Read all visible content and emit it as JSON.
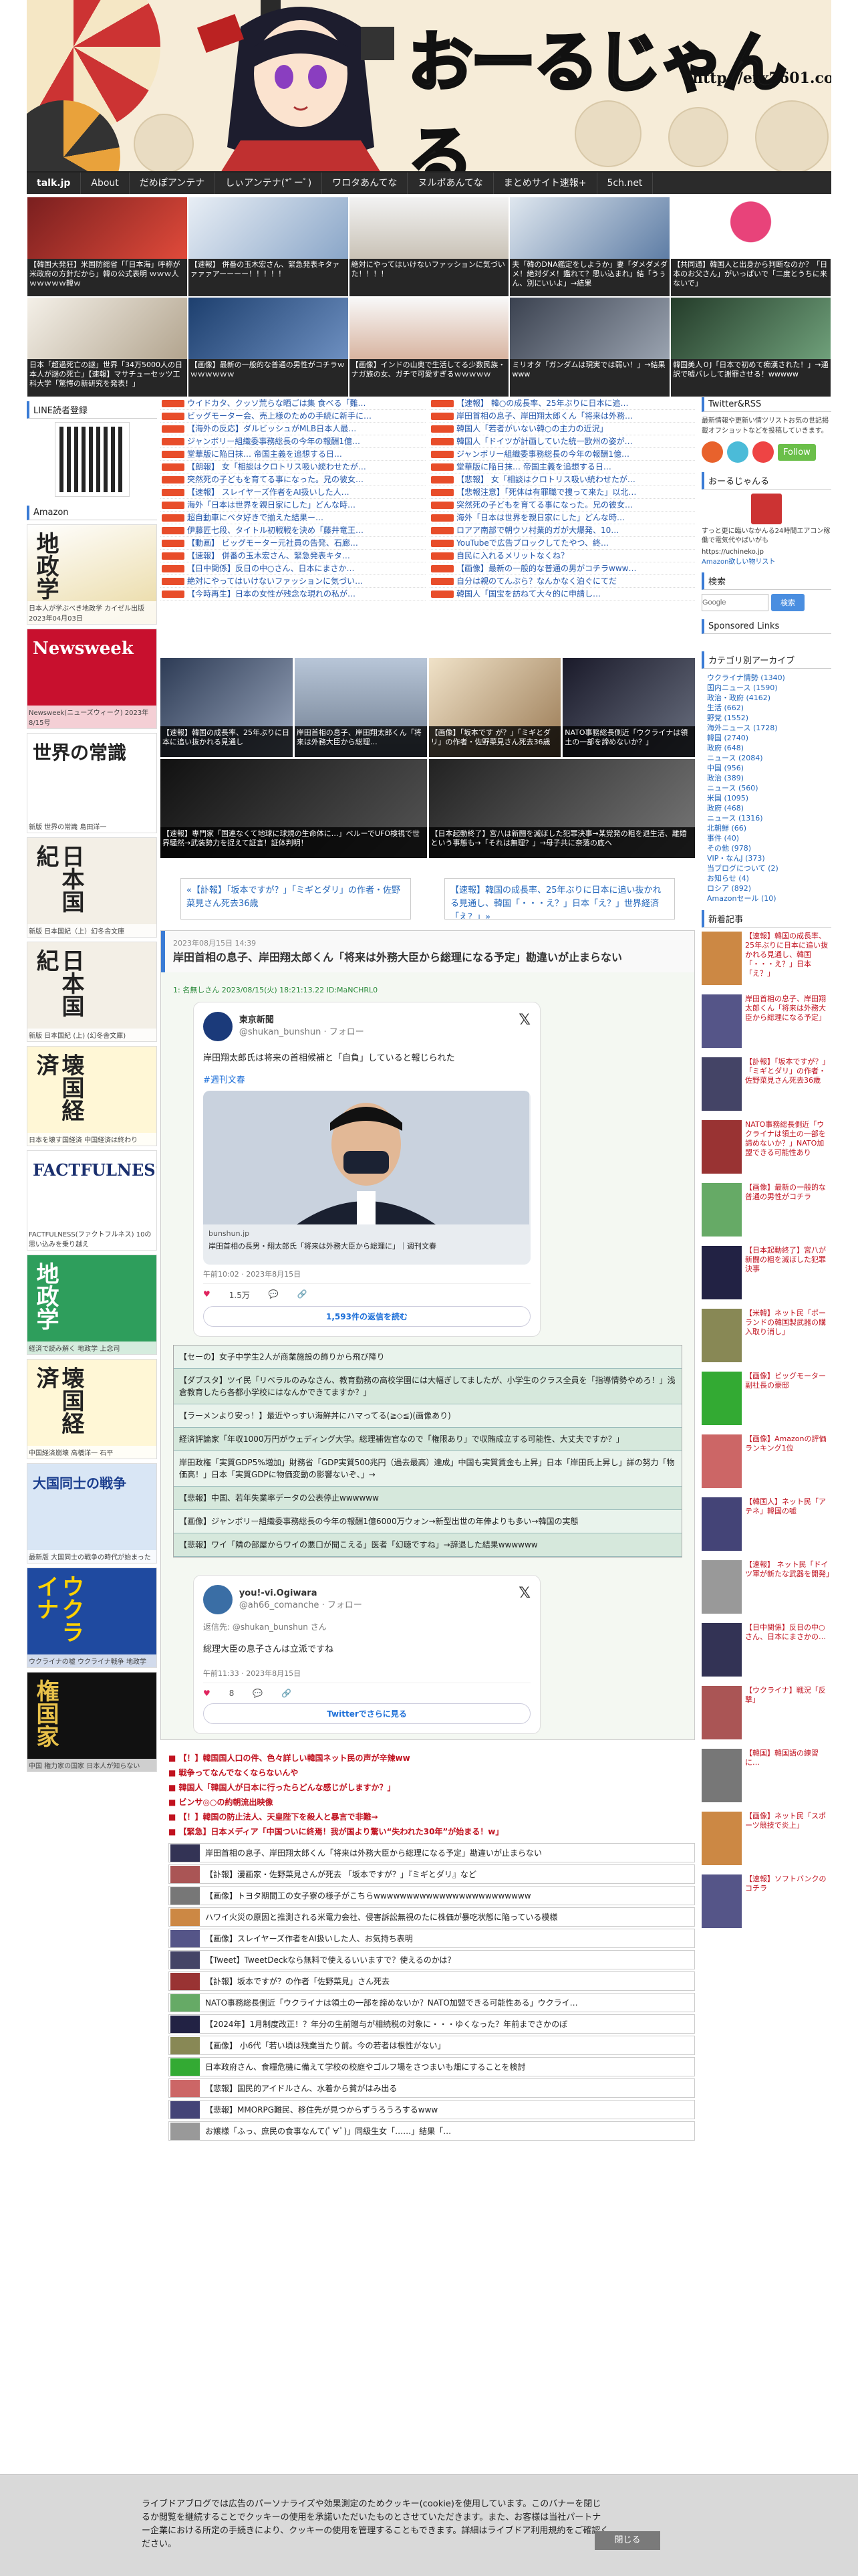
{
  "site": {
    "logo": "おーるじゃんる",
    "url": "http://erx7601.com"
  },
  "nav": [
    "talk.jp",
    "About",
    "だめぽアンテナ",
    "しぃアンテナ(*ﾟーﾟ)",
    "ワロタあんてな",
    "ヌルポあんてな",
    "まとめサイト速報+",
    "5ch.net"
  ],
  "top_thumbs": [
    "【韓国大発狂】米国防総省「「日本海」呼称が米政府の方針だから」韓の公式表明 ｗｗｗ人ｗｗｗｗｗ韓ｗ",
    "【速報】 併番の玉木宏さん、緊急発表キタァァァァアーーーー！！！！！",
    "絶対にやってはいけないファッションに気づいた！！！！",
    "夫「韓のDNA鑑定をしようか」妻「ダメダメダメ！絶対ダメ！鑑れて？思い込まれ」結「うぅん、別にいいよ」→結果",
    "【共同通】韓国人と出身から判断なのか？「日本のお父さん」がいっぱいで「二度とうちに来ないで」",
    "日本「超過死亡の謎」世界「34万5000人の日本人が謎の死亡」【速報】マサチューセッツ工科大学「驚愕の新研究を発表！」",
    "【画像】最新の一般的な普通の男性がコチラｗｗｗｗｗｗｗ",
    "【画像】インドの山奥で生活してる少数民族・ナガ族の女、ガチで可愛すぎるｗｗｗｗｗ",
    "ミリオタ「ガンダムは現実では弱い！」→結果www",
    "韓国美人０J「日本で初めて痴漢された！」→通訳で嘘バレして謝罪させる！wwwww"
  ],
  "left": {
    "line_title": "LINE読者登録",
    "amazon_title": "Amazon",
    "books": [
      {
        "title": "地政学",
        "cap": "日本人が学ぶべき地政学 カイゼル出版 2023年04月03日"
      },
      {
        "title": "Newsweek",
        "cap": "Newsweek(ニューズウィーク) 2023年8/15号"
      },
      {
        "title": "世界の常識",
        "cap": "新版 世界の常識 島田洋一"
      },
      {
        "title": "日本国紀",
        "cap": "新版 日本国紀（上）幻冬舎文庫"
      },
      {
        "title": "日本国紀",
        "cap": "新版 日本国紀 (上) (幻冬舎文庫)"
      },
      {
        "title": "壊国経済",
        "cap": "日本を壊す国経済 中国経済は終わり"
      },
      {
        "title": "FACTFULNESS",
        "cap": "FACTFULNESS(ファクトフルネス) 10の思い込みを乗り越え"
      },
      {
        "title": "地政学",
        "cap": "経済で読み解く 地政学 上念司"
      },
      {
        "title": "壊国経済",
        "cap": "中国経済崩壊 高橋洋一 石平"
      },
      {
        "title": "大国同士の戦争",
        "cap": "最新版 大国同士の戦争の時代が始まった"
      },
      {
        "title": "ウクライナ",
        "cap": "ウクライナの嘘 ウクライナ戦争 地政学"
      },
      {
        "title": "権国家",
        "cap": "中国 権力家の国家 日本人が知らない"
      }
    ]
  },
  "center": {
    "rss_left": [
      "ウイドカタ、クッソ荒らな晒ごは集 食べる「難…",
      "ビッグモーター会、売上様のための手続に新手に…",
      "【海外の反応】ダルビッシュがMLB日本人最…",
      "ジャンボリー組織委事務総長の今年の報酬1億…",
      "堂華版に陥日抹… 帝国主義を追想する日…",
      "【朗報】 女「相談はクロトリス吸い統わせたが…",
      "突然死の子どもを育てる事になった。兄の彼女…",
      "【速報】 スレイヤーズ作者をAI扱いした人…",
      "海外「日本は世界を親日家にした」どんな時…",
      "超自動車にベタ好きで揃えた結果ー…",
      "伊藤匠七段、タイトル初戦戦を決め「藤井竜王…",
      "【動画】 ビッグモーター元社員の告発、石廊…",
      "【速報】 併番の玉木宏さん、緊急発表キタ…",
      "【日中関係】反日の中○さん、日本にまさか…",
      "絶対にやってはいけないファッションに気づい…",
      "【今時再生】日本の女性が残念な現れの私が…"
    ],
    "rss_right": [
      "【速報】 韓○の成長率、25年ぶりに日本に追…",
      "岸田首相の息子、岸田翔太郎くん「将来は外務…",
      "韓国人「若者がいない韓○の主力の近況」",
      "韓国人「ドイツが計画していた統一欧州の姿が…",
      "ジャンボリー組織委事務総長の今年の報酬1億…",
      "堂華版に陥日抹… 帝国主義を追想する日…",
      "【悲報】 女「相談はクロトリス吸い統わせたが…",
      "【悲報注意】「死体は有罪職で捜って来た」以北…",
      "突然死の子どもを育てる事になった。兄の彼女…",
      "海外「日本は世界を親日家にした」どんな時…",
      "ロアア南部で朝ウソ村業的ガが大爆発、10…",
      "YouTubeで広告ブロックしてたやつ、終…",
      "自民に入れるメリットなくね？",
      "【画像】最新の一般的な普通の男がコチラwww…",
      "自分は親のてんぷら？なんかなく泊ぐにてだ",
      "韓国人「国宝を訪ねて大々的に申請し…"
    ],
    "grid": [
      "【速報】韓国の成長率、25年ぶりに日本に追い抜かれる見通し",
      "岸田首相の息子、岸田翔太郎くん「将来は外務大臣から総理…",
      "【画像】「坂本です が？」「ミギとダリ」の作者・佐野菜見さん死去36歳",
      "NATO事務総長側近「ウクライナは領土の一部を諦めないか？」",
      "【速報】専門家「国連なくて地球に球規の生命体に…」ベルーでUFO検視で世界騒然→武装勢力を捉えて証言！証体判明！",
      "",
      "【日本起動終了】宮八は新闘を滅ぼした犯罪決事→某覚発の粗を退生活、離婚という事態も→「それは無理？」→母子共に奈落の底へ",
      ""
    ],
    "prev": "«【訃報】「坂本ですが？」「ミギとダリ」の作者・佐野菜見さん死去36歳",
    "next": "【速報】韓国の成長率、25年ぶりに日本に追い抜かれる見通し、韓国「・・・え？」日本「え？」世界経済「え？」»",
    "article": {
      "date": "2023年08月15日 14:39",
      "title": "岸田首相の息子、岸田翔太郎くん「将来は外務大臣から総理になる予定」勘違いが止まらない",
      "src": "1: 名無しさん 2023/08/15(火) 18:21:13.22 ID:MaNCHRL0"
    },
    "tweet1": {
      "name": "東京新聞",
      "handle": "@shukan_bunshun · フォロー",
      "text": "岸田翔太郎氏は将来の首相候補と「自負」していると報じられた",
      "tag": "#週刊文春",
      "link_site": "bunshun.jp",
      "link_title": "岸田首相の長男・翔太郎氏「将来は外務大臣から総理に」｜週刊文春",
      "time": "午前10:02 · 2023年8月15日",
      "likes": "1.5万",
      "replies": "1,593件の返信を読む"
    },
    "related": [
      "【セーの】女子中学生2人が商業施設の飾りから飛び降り",
      "【ダブスタ】ツイ民「リベラルのみなさん、教育勤務の高校学園には大幅ぎしてましたが、小学生のクラス全員を「指導情勢やめろ！」浅倉教育したら各都小学校にはなんかできてますか？」",
      "【ラーメンより安っ！】最近やっすい海鮮丼にハマってる(≧◇≦)(画像あり)",
      "経済評論家「年収1000万円がウェディング大学。総理補佐官なので「権限あり」で収賄成立する可能性、大丈夫ですか？」",
      "岸田政権「実質GDP5%増加」財務省「GDP実質500兆円（過去最高）達成」中国も実質賃金も上昇」日本「岸田氏上昇し」詳の努力「物価高！」日本「実質GDPに物価変動の影響ないぞ、」→",
      "【悲報】中国、若年失業率データの公表停止wwwwww",
      "【画像】ジャンボリー組織委事務総長の今年の報酬1億6000万ウォン→新型出世の年俸よりも多い→韓国の実態",
      "【悲報】ワイ「隣の部屋からワイの悪口が聞こえる」医者「幻聴ですね」→辞退した結果wwwwww"
    ],
    "tweet2": {
      "name": "you!-vi.Ogiwara",
      "handle": "@ah66_comanche · フォロー",
      "reply": "返信先: @shukan_bunshun さん",
      "text": "総理大臣の息子さんは立派ですね",
      "time": "午前11:33 · 2023年8月15日",
      "likes": "8",
      "btn": "Twitterでさらに見る"
    },
    "red_links": [
      "【！】韓国国人口の件、色々詳しい韓国ネット民の声が辛辣ww",
      "戦争ってなんでなくならないんや",
      "韓国人「韓国人が日本に行ったらどんな感じがしますか？」",
      "ビンサ◎○の約朝流出映像",
      "【！】韓国の防止法人、天皇陛下を殺人と暴言で非難→",
      "【緊急】日本メディア「中国ついに終焉！我が国より驚い“失われた30年”が始まる！w」"
    ],
    "article_links": [
      "岸田首相の息子、岸田翔太郎くん「将来は外務大臣から総理になる予定」勘違いが止まらない",
      "【訃報】漫画家・佐野菜見さんが死去 「坂本ですが？」『ミギとダリ』など",
      "【画像】トヨタ期間工の女子寮の様子がこちらwwwwwwwwwwwwwwwwwwwwwwww",
      "ハワイ火災の原因と推測される米電力会社、侵害訴訟無視のたに株価が暴吃状態に陥っている模様",
      "【画像】スレイヤーズ作者をAI扱いした人、お気持ち表明",
      "【Tweet】TweetDeckなら無料で使えるいいますで？使えるのかは？",
      "【訃報】坂本ですが？の作者「佐野菜見」さん死去",
      "NATO事務総長側近「ウクライナは領土の一部を諦めないか？NATO加盟できる可能性ある」ウクライ…",
      "【2024年】1月制度改正！？年分の生前贈与が相続税の対象に・・・ゆくなった？年前までさかのぼ",
      "【画像】 小6代「若い頃は残業当たり前。今の若者は根性がない」",
      "日本政府さん、食糧危機に備えて学校の校庭やゴルフ場をさつまいも畑にすることを検討",
      "【悲報】国民的アイドルさん、水着から貧がはみ出る",
      "【悲報】MMORPG難民、移住先が見つからずうろうろするwww",
      "お嬢様「ふっ、庶民の食事なんて(ﾟ∀ﾟ)」同級生女「……」結果「…"
    ]
  },
  "right": {
    "twitter_title": "Twitter&RSS",
    "twitter_text": "最新情報や更新い情ツリストお気の世記掲載オフショットなどを投稿していきます。",
    "follow": "Follow",
    "about_title": "おーるじゃんる",
    "about_text": "すっと更に臨いなかんる24時間エアコン稼働で電気代やばいがも",
    "about_url": "https://uchineko.jp",
    "about_link": "Amazon欲しい物リスト",
    "search_title": "検索",
    "search_btn": "検索",
    "sponsored": "Sponsored Links",
    "cat_title": "カテゴリ別アーカイブ",
    "categories": [
      "ウクライナ情勢 (1340)",
      "国内ニュース (1590)",
      "政治・政府 (4162)",
      "生活 (662)",
      "野党 (1552)",
      "海外ニュース (1728)",
      "韓国 (2740)",
      "政府 (648)",
      "ニュース (2084)",
      "中国 (956)",
      "政治 (389)",
      "ニュース (560)",
      "米国 (1095)",
      "政府 (468)",
      "ニュース (1316)",
      "北朝鮮 (66)",
      "事件 (40)",
      "その他 (978)",
      "VIP・なんJ (373)",
      "当ブログについて (2)",
      "お知らせ (4)",
      "ロシア (892)",
      "Amazonセール (10)"
    ],
    "new_title": "新着記事",
    "new_articles": [
      "【速報】韓国の成長率、25年ぶりに日本に追い抜かれる見通し、韓国「・・・え？」日本「え？」",
      "岸田首相の息子、岸田翔太郎くん「将来は外務大臣から総理になる予定」",
      "【訃報】「坂本ですが？」「ミギとダリ」の作者・佐野菜見さん死去36歳",
      "NATO事務総長側近「ウクライナは領土の一部を諦めないか？」NATO加盟できる可能性あり",
      "【画像】最新の一般的な普通の男性がコチラ",
      "【日本起動終了】宮八が新闘の粗を滅ぼした犯罪決事",
      "【米韓】ネット民「ポーランドの韓国製武器の購入取り消し」",
      "【画像】ビッグモーター副社長の豪邸",
      "【画像】Amazonの評価ランキング1位",
      "【韓国人】ネット民「アテネ」韓国の嘘",
      "【速報】 ネット民「ドイツ軍が新たな武器を開発」",
      "【日中関係】反日の中○さん、日本にまさかの…",
      "【ウクライナ】戦況「反撃」",
      "【韓国】韓国語の練習に…",
      "【画像】ネット民「スポーツ競技で炎上」",
      "【速報】ソフトバンクのコチラ"
    ]
  },
  "cookie": {
    "text": "ライブドアブログでは広告のパーソナライズや効果測定のためクッキー(cookie)を使用しています。このバナーを閉じるか閲覧を継続することでクッキーの使用を承諾いただいたものとさせていただきます。また、お客様は当社パートナー企業における所定の手続きにより、クッキーの使用を管理することもできます。詳細はライブドア利用規約をご確認ください。",
    "button": "閉じる"
  }
}
